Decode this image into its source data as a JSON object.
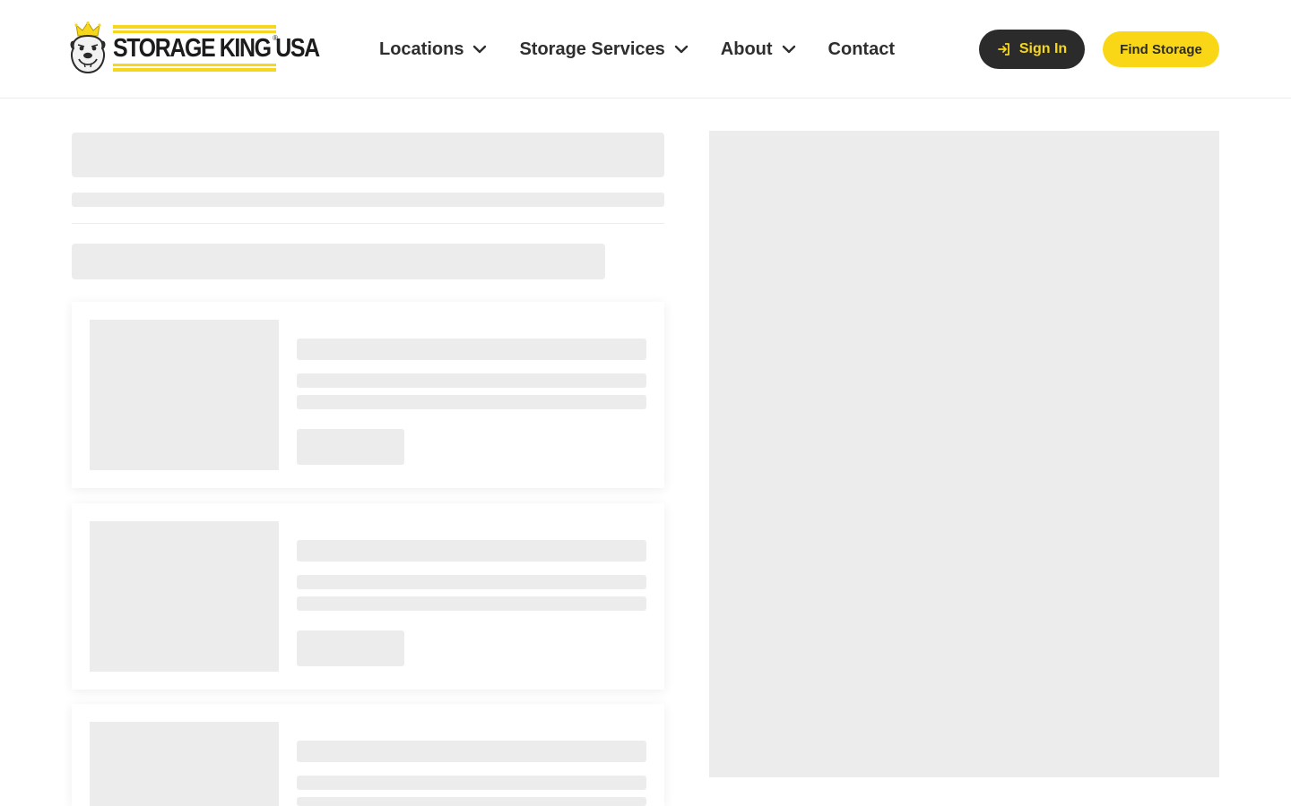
{
  "brand": {
    "name": "STORAGE KING USA",
    "registered": "®",
    "accent": "#f6d71e",
    "dark": "#2b2b2b"
  },
  "nav": {
    "items": [
      {
        "label": "Locations",
        "has_dropdown": true
      },
      {
        "label": "Storage Services",
        "has_dropdown": true
      },
      {
        "label": "About",
        "has_dropdown": true
      },
      {
        "label": "Contact",
        "has_dropdown": false
      }
    ]
  },
  "actions": {
    "sign_in_label": "Sign In",
    "sign_in_icon": "sign-in-icon",
    "find_storage_label": "Find Storage"
  },
  "content": {
    "state": "loading",
    "skeleton_color": "#ececec",
    "card_count_visible": 3
  }
}
